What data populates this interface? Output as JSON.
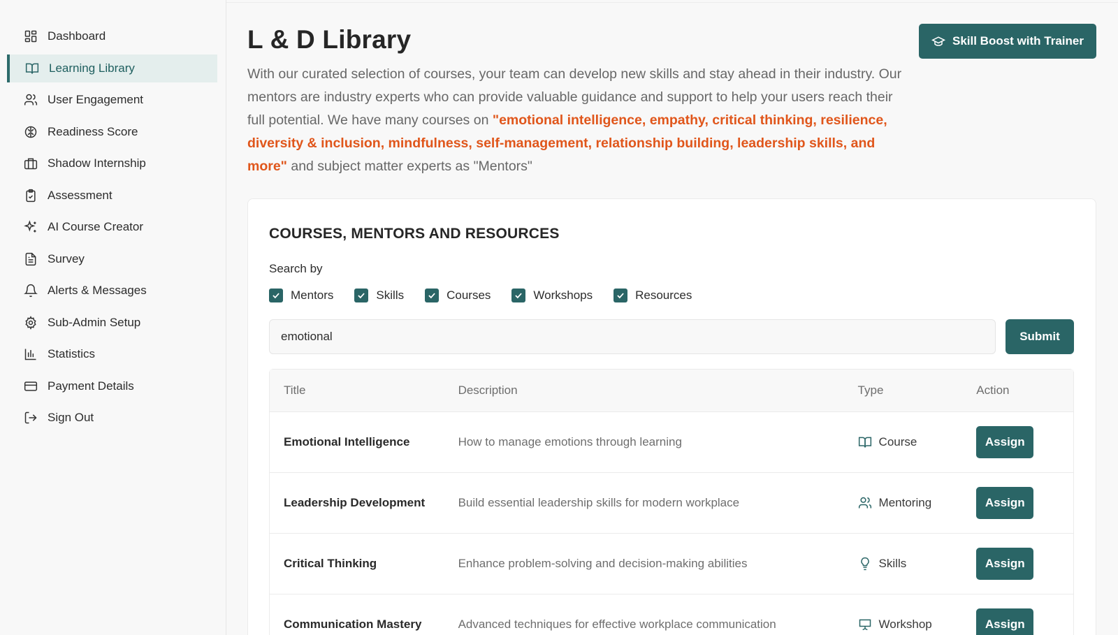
{
  "sidebar": {
    "items": [
      {
        "label": "Dashboard",
        "icon": "dashboard-icon",
        "active": false
      },
      {
        "label": "Learning Library",
        "icon": "book-open-icon",
        "active": true
      },
      {
        "label": "User Engagement",
        "icon": "users-icon",
        "active": false
      },
      {
        "label": "Readiness Score",
        "icon": "brain-icon",
        "active": false
      },
      {
        "label": "Shadow Internship",
        "icon": "briefcase-icon",
        "active": false
      },
      {
        "label": "Assessment",
        "icon": "clipboard-check-icon",
        "active": false
      },
      {
        "label": "AI Course Creator",
        "icon": "sparkles-icon",
        "active": false
      },
      {
        "label": "Survey",
        "icon": "file-text-icon",
        "active": false
      },
      {
        "label": "Alerts & Messages",
        "icon": "bell-icon",
        "active": false
      },
      {
        "label": "Sub-Admin Setup",
        "icon": "gear-icon",
        "active": false
      },
      {
        "label": "Statistics",
        "icon": "bar-chart-icon",
        "active": false
      },
      {
        "label": "Payment Details",
        "icon": "credit-card-icon",
        "active": false
      },
      {
        "label": "Sign Out",
        "icon": "log-out-icon",
        "active": false
      }
    ]
  },
  "header": {
    "title": "L & D Library",
    "boost_button": "Skill Boost with Trainer"
  },
  "intro": {
    "text_before": "With our curated selection of courses, your team can develop new skills and stay ahead in their industry. Our mentors are industry experts who can provide valuable guidance and support to help your users reach their full potential. We have many courses on ",
    "highlight": "\"emotional intelligence, empathy, critical thinking, resilience, diversity & inclusion, mindfulness, self-management, relationship building, leadership skills, and more\"",
    "text_after": " and subject matter experts as \"Mentors\""
  },
  "card": {
    "title": "COURSES, MENTORS AND RESOURCES",
    "search_label": "Search by",
    "filters": [
      {
        "label": "Mentors",
        "checked": true
      },
      {
        "label": "Skills",
        "checked": true
      },
      {
        "label": "Courses",
        "checked": true
      },
      {
        "label": "Workshops",
        "checked": true
      },
      {
        "label": "Resources",
        "checked": true
      }
    ],
    "search_value": "emotional",
    "submit_label": "Submit"
  },
  "table": {
    "columns": [
      "Title",
      "Description",
      "Type",
      "Action"
    ],
    "rows": [
      {
        "title": "Emotional Intelligence",
        "description": "How to manage emotions through learning",
        "type": "Course",
        "type_icon": "book-open-icon",
        "action": "Assign"
      },
      {
        "title": "Leadership Development",
        "description": "Build essential leadership skills for modern workplace",
        "type": "Mentoring",
        "type_icon": "users-icon",
        "action": "Assign"
      },
      {
        "title": "Critical Thinking",
        "description": "Enhance problem-solving and decision-making abilities",
        "type": "Skills",
        "type_icon": "lightbulb-icon",
        "action": "Assign"
      },
      {
        "title": "Communication Mastery",
        "description": "Advanced techniques for effective workplace communication",
        "type": "Workshop",
        "type_icon": "presentation-icon",
        "action": "Assign"
      }
    ]
  },
  "colors": {
    "accent": "#2a6566",
    "highlight": "#e0561b",
    "active_bg": "#e4eeed"
  }
}
